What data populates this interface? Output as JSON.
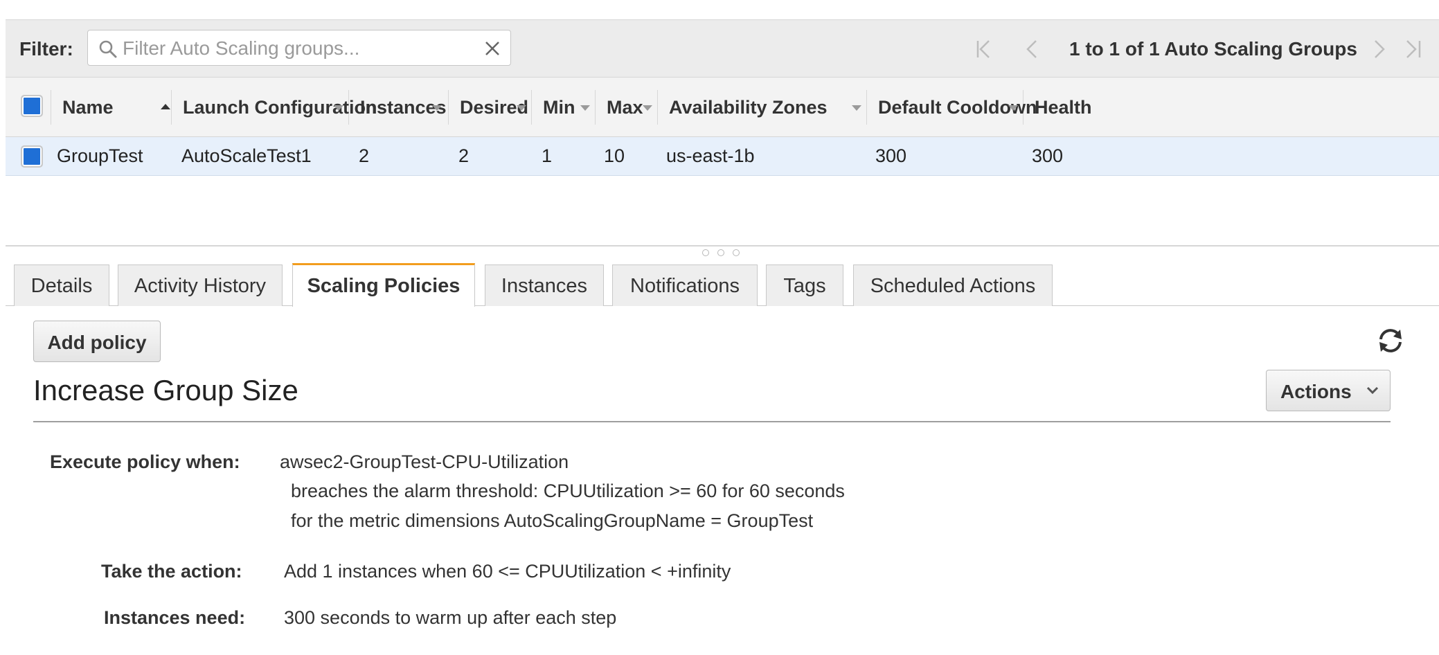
{
  "filter": {
    "label": "Filter:",
    "placeholder": "Filter Auto Scaling groups...",
    "value": ""
  },
  "pager": {
    "text": "1 to 1 of 1 Auto Scaling Groups"
  },
  "table": {
    "columns": {
      "name": "Name",
      "launch_configuration": "Launch Configuration",
      "instances": "Instances",
      "desired": "Desired",
      "min": "Min",
      "max": "Max",
      "availability_zones": "Availability Zones",
      "default_cooldown": "Default Cooldown",
      "health": "Health"
    },
    "rows": [
      {
        "name": "GroupTest",
        "launch_configuration": "AutoScaleTest1",
        "instances": "2",
        "desired": "2",
        "min": "1",
        "max": "10",
        "availability_zones": "us-east-1b",
        "default_cooldown": "300",
        "health": "300"
      }
    ]
  },
  "tabs": [
    {
      "label": "Details"
    },
    {
      "label": "Activity History"
    },
    {
      "label": "Scaling Policies",
      "active": true
    },
    {
      "label": "Instances"
    },
    {
      "label": "Notifications"
    },
    {
      "label": "Tags"
    },
    {
      "label": "Scheduled Actions"
    }
  ],
  "panel": {
    "add_policy_label": "Add policy",
    "actions_label": "Actions",
    "policy": {
      "title": "Increase Group Size",
      "execute_label": "Execute policy when:",
      "execute_alarm": "awsec2-GroupTest-CPU-Utilization",
      "execute_threshold": "breaches the alarm threshold: CPUUtilization >= 60 for 60 seconds",
      "execute_dimensions": "for the metric dimensions AutoScalingGroupName = GroupTest",
      "action_label": "Take the action:",
      "action_value": "Add 1 instances when 60 <= CPUUtilization < +infinity",
      "warmup_label": "Instances need:",
      "warmup_value": "300 seconds to warm up after each step"
    }
  },
  "colors": {
    "accent_tab": "#f29d1e",
    "checkbox": "#1f6fd6",
    "selected_row": "#e7f0fb"
  }
}
